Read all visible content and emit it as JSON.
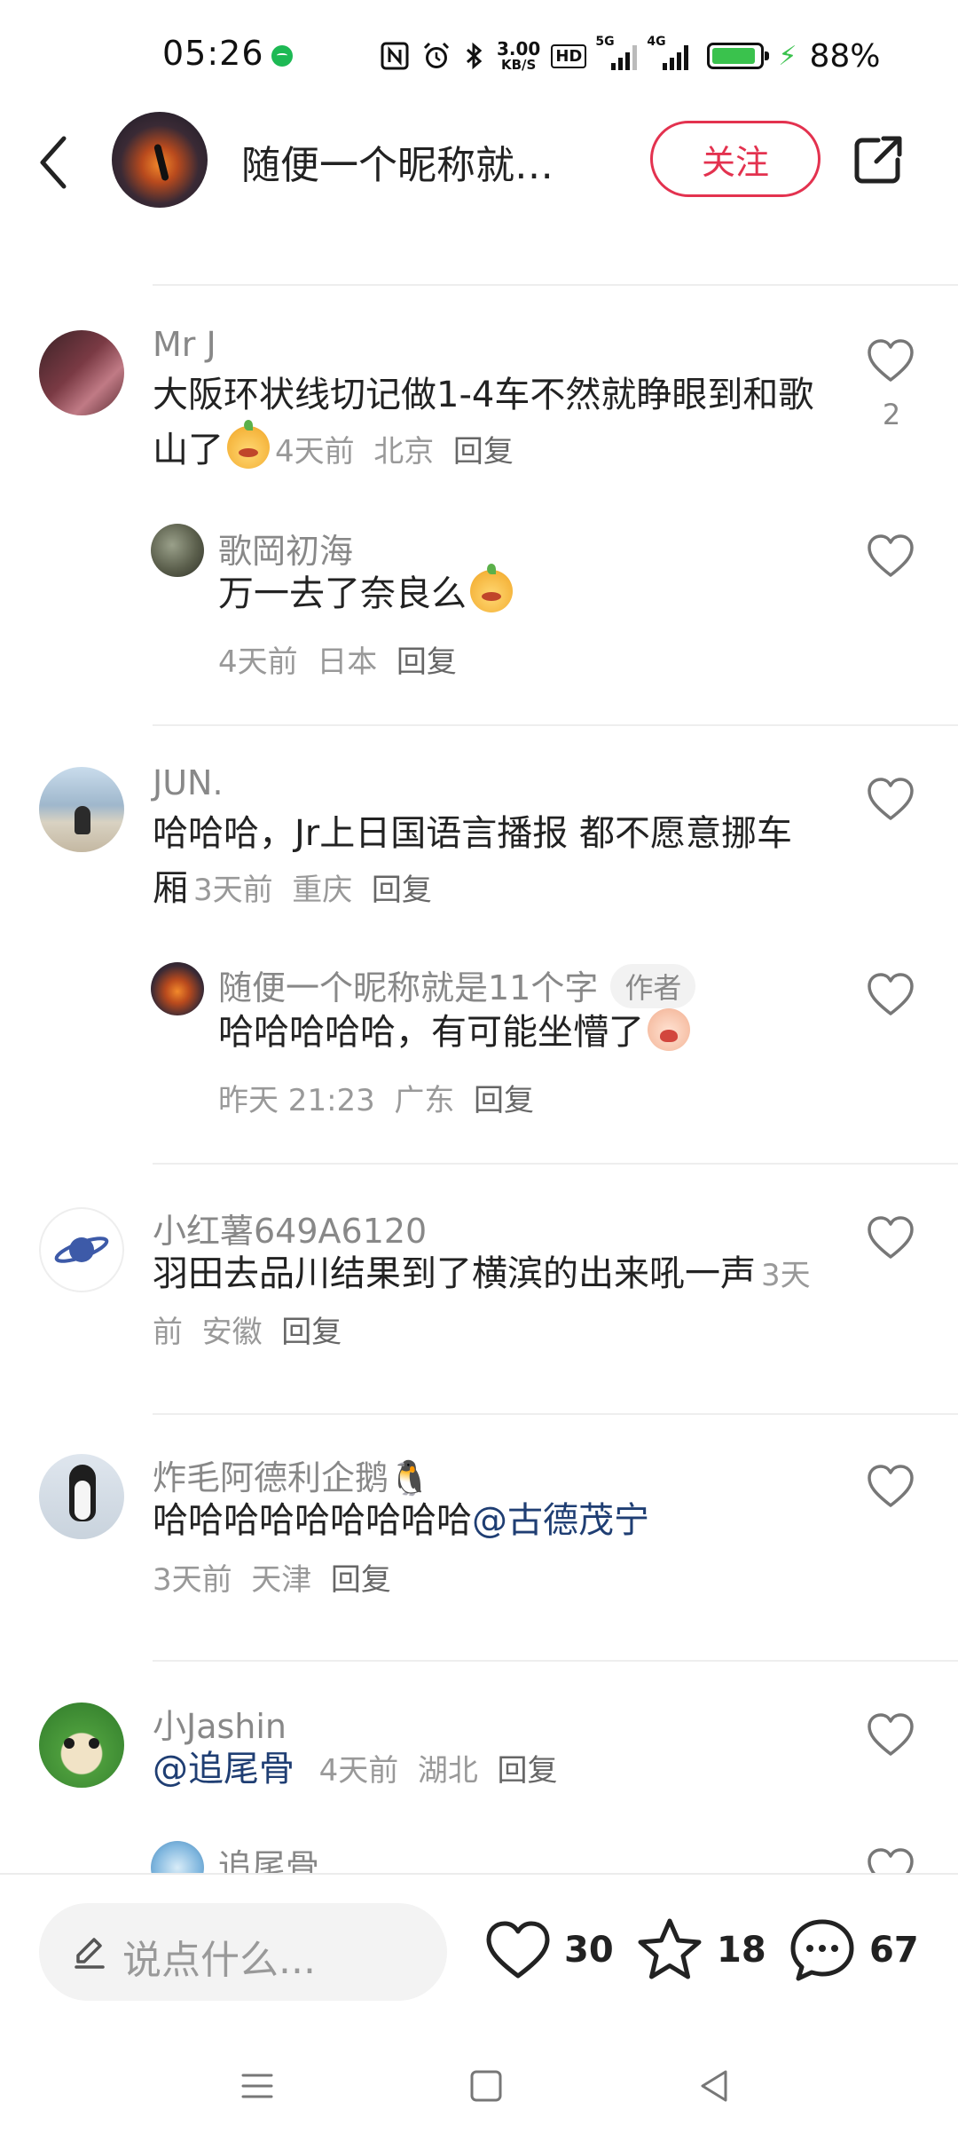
{
  "status_bar": {
    "time": "05:26",
    "speed": "3.00",
    "speed_unit": "KB/S",
    "hd_label": "HD",
    "net1_label": "5G",
    "net2_label": "4G",
    "battery_pct": "88%",
    "battery_level": 0.88,
    "spotify_color": "#1db954",
    "battery_color": "#3ac24d"
  },
  "header": {
    "back_icon": "chevron-left-icon",
    "name": "随便一个昵称就…",
    "follow_label": "关注",
    "share_icon": "share-icon",
    "accent": "#e3324f"
  },
  "comments": [
    {
      "name": "Mr J",
      "text": "大阪环状线切记做1-4车不然就睁眼到和歌山了",
      "emoji": "chick-emoji",
      "time": "4天前",
      "region": "北京",
      "reply": "回复",
      "likes": "2",
      "replies": [
        {
          "name": "歌岡初海",
          "text": "万一去了奈良么",
          "emoji": "chick-emoji",
          "time": "4天前",
          "region": "日本",
          "reply": "回复"
        }
      ]
    },
    {
      "name": "JUN.",
      "text": "哈哈哈，Jr上日国语言播报 都不愿意挪车厢",
      "time": "3天前",
      "region": "重庆",
      "reply": "回复",
      "replies": [
        {
          "name": "随便一个昵称就是11个字",
          "author_tag": "作者",
          "text": "哈哈哈哈哈，有可能坐懵了",
          "emoji": "crying-emoji",
          "time": "昨天 21:23",
          "region": "广东",
          "reply": "回复"
        }
      ]
    },
    {
      "name": "小红薯649A6120",
      "text": "羽田去品川结果到了横滨的出来吼一声",
      "time": "3天前",
      "region": "安徽",
      "reply": "回复"
    },
    {
      "name": "炸毛阿德利企鹅🐧",
      "text": "哈哈哈哈哈哈哈哈哈",
      "mention": "@古德茂宁",
      "time": "3天前",
      "region": "天津",
      "reply": "回复"
    },
    {
      "name": "小Jashin",
      "mention": "@追尾骨",
      "time": "4天前",
      "region": "湖北",
      "reply": "回复",
      "replies": [
        {
          "name": "追尾骨"
        }
      ]
    }
  ],
  "bottom_bar": {
    "input_placeholder": "说点什么...",
    "likes": "30",
    "favorites": "18",
    "comments": "67"
  }
}
